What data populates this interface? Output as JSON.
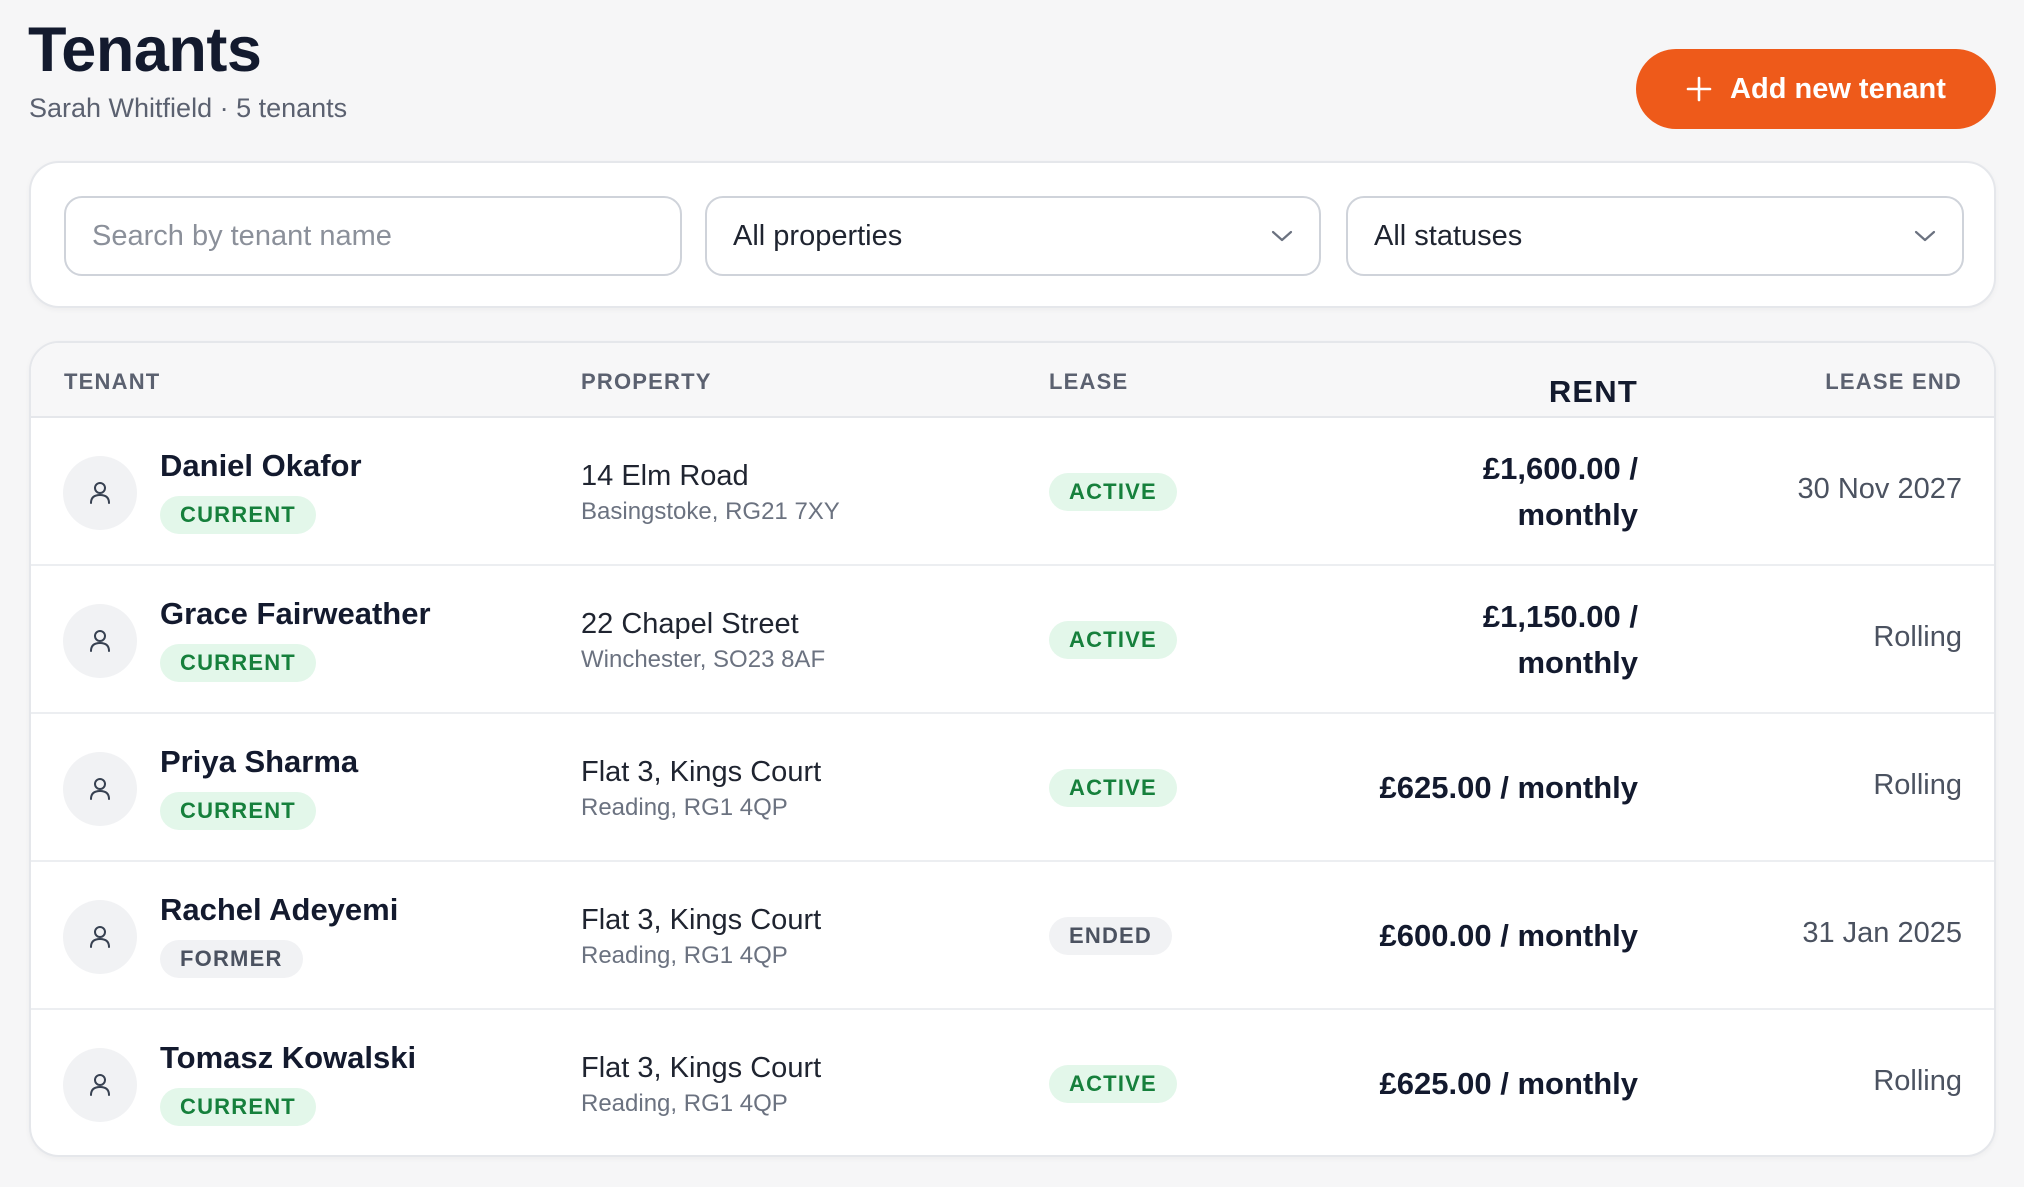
{
  "header": {
    "title": "Tenants",
    "subtitle": "Sarah Whitfield · 5 tenants",
    "add_button_label": "Add new tenant",
    "add_button_icon": "plus-icon"
  },
  "filters": {
    "search_placeholder": "Search by tenant name",
    "search_value": "",
    "property_filter": "All properties",
    "status_filter": "All statuses"
  },
  "table": {
    "columns": {
      "tenant": "TENANT",
      "property": "PROPERTY",
      "lease": "LEASE",
      "rent": "RENT",
      "lease_end": "LEASE END"
    },
    "rows": [
      {
        "name": "Daniel Okafor",
        "tenant_status": "CURRENT",
        "property_line1": "14 Elm Road",
        "property_line2": "Basingstoke, RG21 7XY",
        "lease_status": "ACTIVE",
        "rent_line1": "£1,600.00 /",
        "rent_line2": "monthly",
        "lease_end": "30 Nov 2027"
      },
      {
        "name": "Grace Fairweather",
        "tenant_status": "CURRENT",
        "property_line1": "22 Chapel Street",
        "property_line2": "Winchester, SO23 8AF",
        "lease_status": "ACTIVE",
        "rent_line1": "£1,150.00 /",
        "rent_line2": "monthly",
        "lease_end": "Rolling"
      },
      {
        "name": "Priya Sharma",
        "tenant_status": "CURRENT",
        "property_line1": "Flat 3, Kings Court",
        "property_line2": "Reading, RG1 4QP",
        "lease_status": "ACTIVE",
        "rent": "£625.00 / monthly",
        "lease_end": "Rolling"
      },
      {
        "name": "Rachel Adeyemi",
        "tenant_status": "FORMER",
        "property_line1": "Flat 3, Kings Court",
        "property_line2": "Reading, RG1 4QP",
        "lease_status": "ENDED",
        "rent": "£600.00 / monthly",
        "lease_end": "31 Jan 2025"
      },
      {
        "name": "Tomasz Kowalski",
        "tenant_status": "CURRENT",
        "property_line1": "Flat 3, Kings Court",
        "property_line2": "Reading, RG1 4QP",
        "lease_status": "ACTIVE",
        "rent": "£625.00 / monthly",
        "lease_end": "Rolling"
      }
    ]
  },
  "colors": {
    "accent": "#ee5a1a",
    "status_green_bg": "#e3f7ea",
    "status_green_text": "#16803c",
    "status_gray_bg": "#f1f2f4",
    "status_gray_text": "#4b5260"
  }
}
